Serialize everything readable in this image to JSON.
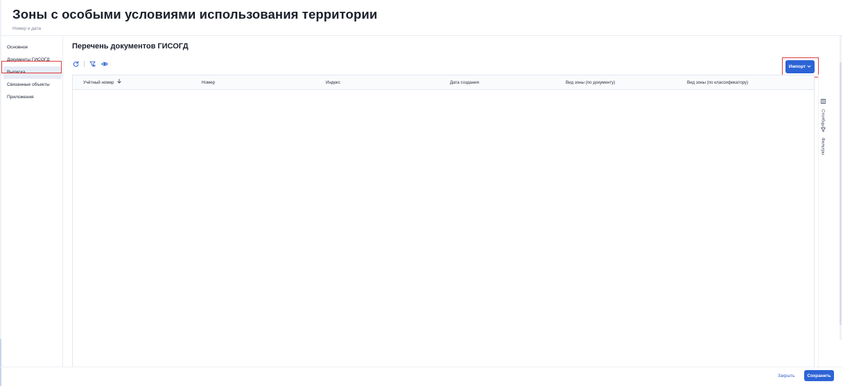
{
  "page": {
    "title": "Зоны с особыми условиями использования территории",
    "subtitle": "Номер и дата"
  },
  "sidenav": {
    "items": [
      {
        "label": "Основное"
      },
      {
        "label": "Документы ГИСОГД"
      },
      {
        "label": "Выписка",
        "active": true
      },
      {
        "label": "Связанные объекты"
      },
      {
        "label": "Приложения"
      }
    ]
  },
  "main": {
    "section_title": "Перечень документов ГИСОГД",
    "toolbar": {
      "icons": [
        "refresh-icon",
        "clear-filter-icon",
        "view-icon"
      ]
    },
    "import_label": "Импорт",
    "table": {
      "columns": [
        {
          "label": "Учётный номер",
          "sort": "desc"
        },
        {
          "label": "Номер"
        },
        {
          "label": "Индекс"
        },
        {
          "label": "Дата создания"
        },
        {
          "label": "Вид зоны (по документу)"
        },
        {
          "label": "Вид зоны (по классификатору)"
        }
      ],
      "rows": []
    }
  },
  "side_panel": {
    "columns_label": "Столбцы",
    "filters_label": "Фильтры"
  },
  "footer": {
    "close_label": "Закрыть",
    "save_label": "Сохранить"
  },
  "colors": {
    "primary": "#2d63d6",
    "highlight": "#e03a3a",
    "active_nav_bg": "#e7ecf6"
  }
}
